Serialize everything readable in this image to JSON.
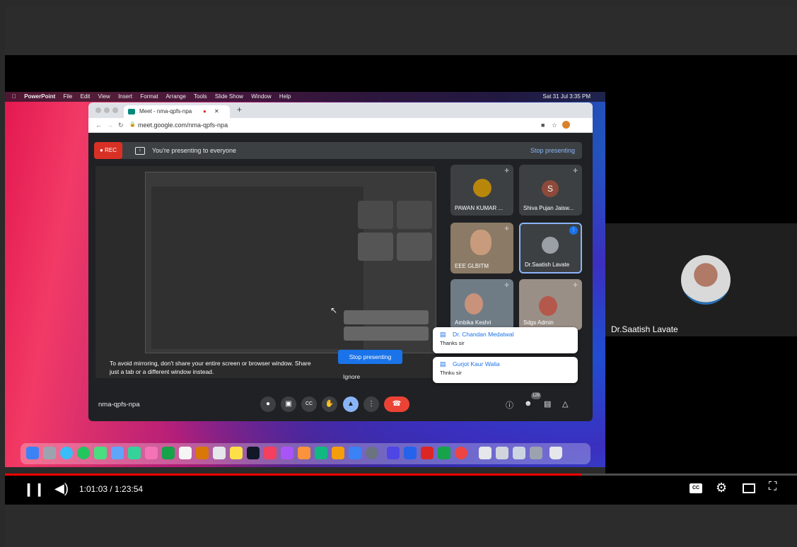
{
  "menubar": {
    "app": "PowerPoint",
    "items": [
      "File",
      "Edit",
      "View",
      "Insert",
      "Format",
      "Arrange",
      "Tools",
      "Slide Show",
      "Window",
      "Help"
    ],
    "clock": "Sat 31 Jul  3:35 PM"
  },
  "browser": {
    "tab_title": "Meet - nma-qpfs-npa",
    "url": "meet.google.com/nma-qpfs-npa"
  },
  "meet": {
    "rec_label": "REC",
    "presenting_text": "You're presenting to everyone",
    "stop_presenting_top": "Stop presenting",
    "mirror_warning_1": "To avoid mirroring, don't share your entire screen or browser window. Share",
    "mirror_warning_2": "just a tab or a different window instead.",
    "stop_presenting_button": "Stop presenting",
    "ignore_button": "Ignore",
    "meeting_code": "nma-qpfs-npa",
    "participant_count": "129",
    "participants": [
      {
        "name": "PAWAN KUMAR ...",
        "initial": ""
      },
      {
        "name": "Shiva Pujan Jaisw...",
        "initial": "S"
      },
      {
        "name": "EEE GLBITM",
        "initial": ""
      },
      {
        "name": "Dr.Saatish Lavate",
        "initial": ""
      },
      {
        "name": "Ambika Keshri",
        "initial": ""
      },
      {
        "name": "Sdgs Admin",
        "initial": ""
      }
    ],
    "notifications": [
      {
        "who": "Dr. Chandan Medatwal",
        "msg": "Thanks sir"
      },
      {
        "who": "Gurjot Kaur Walia",
        "msg": "Thnku sir"
      }
    ]
  },
  "side_panel": {
    "speaker_name": "Dr.Saatish Lavate"
  },
  "player": {
    "time": "1:01:03 / 1:23:54",
    "progress": 0.7276,
    "icons": [
      "pause-icon",
      "volume-icon",
      "captions-icon",
      "settings-icon",
      "miniplayer-icon",
      "fullscreen-icon"
    ]
  },
  "colors": {
    "youtube_red": "#ff0000",
    "meet_blue": "#1a73e8",
    "end_call_red": "#ea4335"
  }
}
